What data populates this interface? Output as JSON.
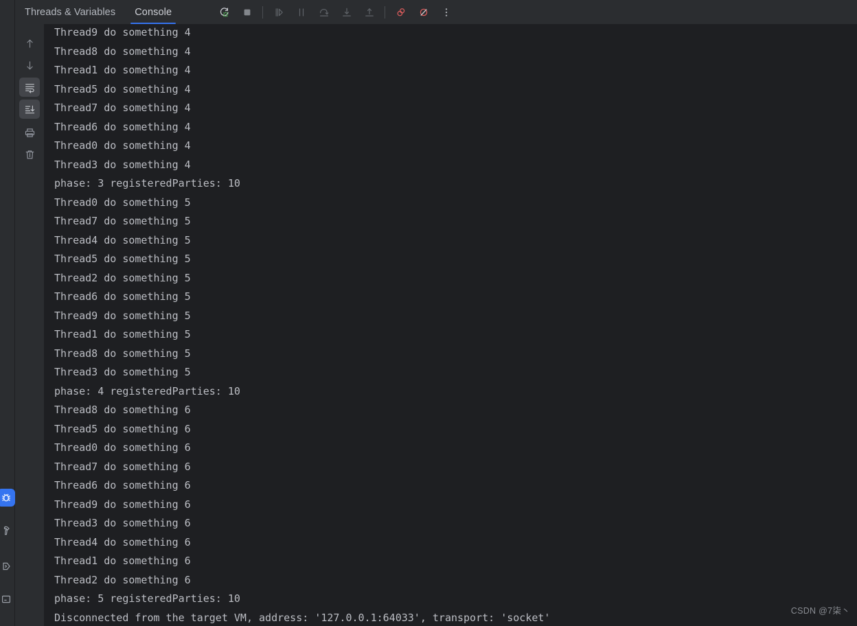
{
  "window": {
    "background": "#1e1f22",
    "header_background": "#2b2d30",
    "accent": "#3574f0",
    "text_color": "#bcbec4",
    "breakpoint_red": "#db5c5c"
  },
  "left_strip": {
    "items": [
      {
        "name": "debug-tool-window",
        "icon": "bug-icon",
        "selected": true
      },
      {
        "name": "build-tool-window",
        "icon": "hammer-icon",
        "selected": false
      },
      {
        "name": "services-tool-window",
        "icon": "services-icon",
        "selected": false
      },
      {
        "name": "terminal-tool-window",
        "icon": "terminal-icon",
        "selected": false
      }
    ]
  },
  "header": {
    "tabs": [
      {
        "label": "Threads & Variables",
        "active": false
      },
      {
        "label": "Console",
        "active": true
      }
    ],
    "toolbar": [
      {
        "name": "rerun-debug-button",
        "icon": "rerun-debug-icon",
        "enabled": true
      },
      {
        "name": "stop-button",
        "icon": "stop-icon",
        "enabled": true
      },
      {
        "name": "resume-program-button",
        "icon": "resume-icon",
        "enabled": false
      },
      {
        "name": "pause-program-button",
        "icon": "pause-icon",
        "enabled": false
      },
      {
        "name": "step-over-button",
        "icon": "step-over-icon",
        "enabled": false
      },
      {
        "name": "step-into-button",
        "icon": "step-into-icon",
        "enabled": false
      },
      {
        "name": "step-out-button",
        "icon": "step-out-icon",
        "enabled": false
      },
      {
        "name": "view-breakpoints-button",
        "icon": "breakpoints-icon",
        "enabled": true
      },
      {
        "name": "mute-breakpoints-button",
        "icon": "mute-breakpoints-icon",
        "enabled": true
      },
      {
        "name": "more-options-button",
        "icon": "kebab-menu-icon",
        "enabled": true
      }
    ]
  },
  "console_sidebar": {
    "items": [
      {
        "name": "scroll-up-button",
        "icon": "arrow-up-icon",
        "selected": false
      },
      {
        "name": "scroll-down-button",
        "icon": "arrow-down-icon",
        "selected": false
      },
      {
        "name": "soft-wrap-button",
        "icon": "soft-wrap-icon",
        "selected": true
      },
      {
        "name": "scroll-to-end-button",
        "icon": "scroll-to-end-icon",
        "selected": true
      },
      {
        "name": "print-button",
        "icon": "printer-icon",
        "selected": false
      },
      {
        "name": "clear-all-button",
        "icon": "trash-icon",
        "selected": false
      }
    ]
  },
  "console": {
    "lines": [
      "Thread9 do something 4",
      "Thread8 do something 4",
      "Thread1 do something 4",
      "Thread5 do something 4",
      "Thread7 do something 4",
      "Thread6 do something 4",
      "Thread0 do something 4",
      "Thread3 do something 4",
      "phase: 3 registeredParties: 10",
      "Thread0 do something 5",
      "Thread7 do something 5",
      "Thread4 do something 5",
      "Thread5 do something 5",
      "Thread2 do something 5",
      "Thread6 do something 5",
      "Thread9 do something 5",
      "Thread1 do something 5",
      "Thread8 do something 5",
      "Thread3 do something 5",
      "phase: 4 registeredParties: 10",
      "Thread8 do something 6",
      "Thread5 do something 6",
      "Thread0 do something 6",
      "Thread7 do something 6",
      "Thread6 do something 6",
      "Thread9 do something 6",
      "Thread3 do something 6",
      "Thread4 do something 6",
      "Thread1 do something 6",
      "Thread2 do something 6",
      "phase: 5 registeredParties: 10",
      "Disconnected from the target VM, address: '127.0.0.1:64033', transport: 'socket'"
    ]
  },
  "watermark": {
    "text": "CSDN @7柒丶"
  }
}
